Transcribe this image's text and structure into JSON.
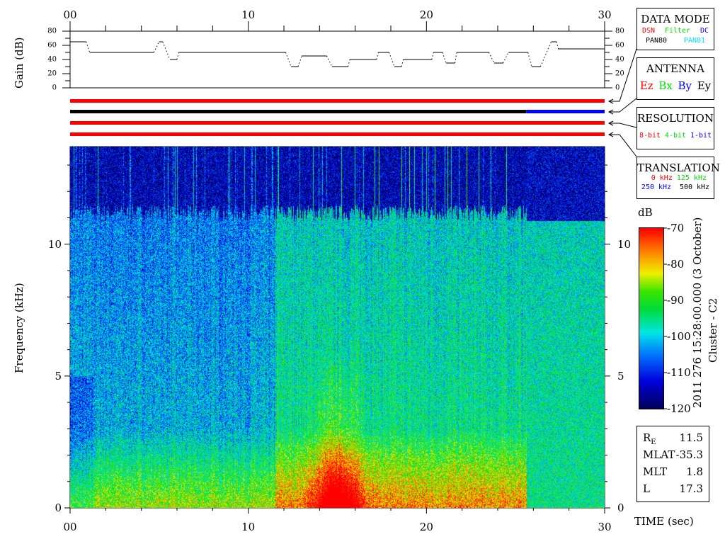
{
  "chart_data": {
    "type": "heatmap",
    "title": "2011 276 15:28:00.000 (3 October)",
    "subtitle": "Cluster - C2",
    "xlabel": "TIME (sec)",
    "ylabel": "Frequency (kHz)",
    "xlim": [
      0,
      30
    ],
    "ylim": [
      0,
      13.7
    ],
    "x_ticks": [
      "00",
      "10",
      "20",
      "30"
    ],
    "y_ticks": [
      "0",
      "5",
      "10"
    ],
    "colorbar": {
      "label": "dB",
      "range": [
        -120,
        -70
      ],
      "ticks": [
        "-70",
        "-80",
        "-90",
        "-100",
        "-110",
        "-120"
      ]
    },
    "gain_panel": {
      "ylabel": "Gain (dB)",
      "ylim": [
        0,
        80
      ],
      "y_ticks": [
        "0",
        "20",
        "40",
        "60",
        "80"
      ],
      "steps": [
        [
          0,
          0.9,
          65
        ],
        [
          1.1,
          4.7,
          50
        ],
        [
          5.0,
          5.2,
          65
        ],
        [
          5.6,
          6.0,
          40
        ],
        [
          6.1,
          12.1,
          50
        ],
        [
          12.4,
          12.8,
          30
        ],
        [
          13.0,
          14.4,
          45
        ],
        [
          14.7,
          15.6,
          30
        ],
        [
          15.7,
          17.2,
          40
        ],
        [
          17.3,
          17.9,
          50
        ],
        [
          18.2,
          18.6,
          30
        ],
        [
          18.7,
          20.3,
          40
        ],
        [
          20.4,
          20.9,
          50
        ],
        [
          21.1,
          21.6,
          35
        ],
        [
          21.7,
          23.5,
          50
        ],
        [
          23.8,
          24.3,
          35
        ],
        [
          24.6,
          25.7,
          50
        ],
        [
          25.9,
          26.4,
          30
        ],
        [
          27.0,
          27.3,
          65
        ],
        [
          27.4,
          30,
          55
        ]
      ]
    },
    "status_bars": [
      {
        "name": "data-mode",
        "segments": [
          [
            0,
            30,
            "#ff0000"
          ]
        ]
      },
      {
        "name": "antenna",
        "segments": [
          [
            0,
            25.6,
            "#000000"
          ],
          [
            25.6,
            30,
            "#0000ff"
          ]
        ]
      },
      {
        "name": "resolution",
        "segments": [
          [
            0,
            30,
            "#ff0000"
          ]
        ]
      },
      {
        "name": "translation",
        "segments": [
          [
            0,
            30,
            "#ff0000"
          ]
        ]
      }
    ]
  },
  "legend": {
    "data_mode": {
      "title": "DATA MODE",
      "items": [
        {
          "label": "DSN",
          "color": "#ff0000"
        },
        {
          "label": "Filter",
          "color": "#00e000"
        },
        {
          "label": "DC",
          "color": "#0000ff"
        },
        {
          "label": "PAN80",
          "color": "#000000"
        },
        {
          "label": "PAN81",
          "color": "#00e0ff"
        }
      ]
    },
    "antenna": {
      "title": "ANTENNA",
      "items": [
        {
          "label": "Ez",
          "color": "#ff0000"
        },
        {
          "label": "Bx",
          "color": "#00e000"
        },
        {
          "label": "By",
          "color": "#0000ff"
        },
        {
          "label": "Ey",
          "color": "#000000"
        }
      ]
    },
    "resolution": {
      "title": "RESOLUTION",
      "items": [
        {
          "label": "8-bit",
          "color": "#ff0000"
        },
        {
          "label": "4-bit",
          "color": "#00e000"
        },
        {
          "label": "1-bit",
          "color": "#0000ff"
        }
      ]
    },
    "translation": {
      "title": "TRANSLATION",
      "items": [
        {
          "label": "0 kHz",
          "color": "#ff0000"
        },
        {
          "label": "125 kHz",
          "color": "#00e000"
        },
        {
          "label": "250 kHz",
          "color": "#0000ff"
        },
        {
          "label": "500 kHz",
          "color": "#000000"
        }
      ]
    }
  },
  "orbit": [
    {
      "label": "R",
      "sub": "E",
      "value": "11.5"
    },
    {
      "label": "MLAT",
      "value": "-35.3"
    },
    {
      "label": "MLT",
      "value": "1.8"
    },
    {
      "label": "L",
      "value": "17.3"
    }
  ]
}
